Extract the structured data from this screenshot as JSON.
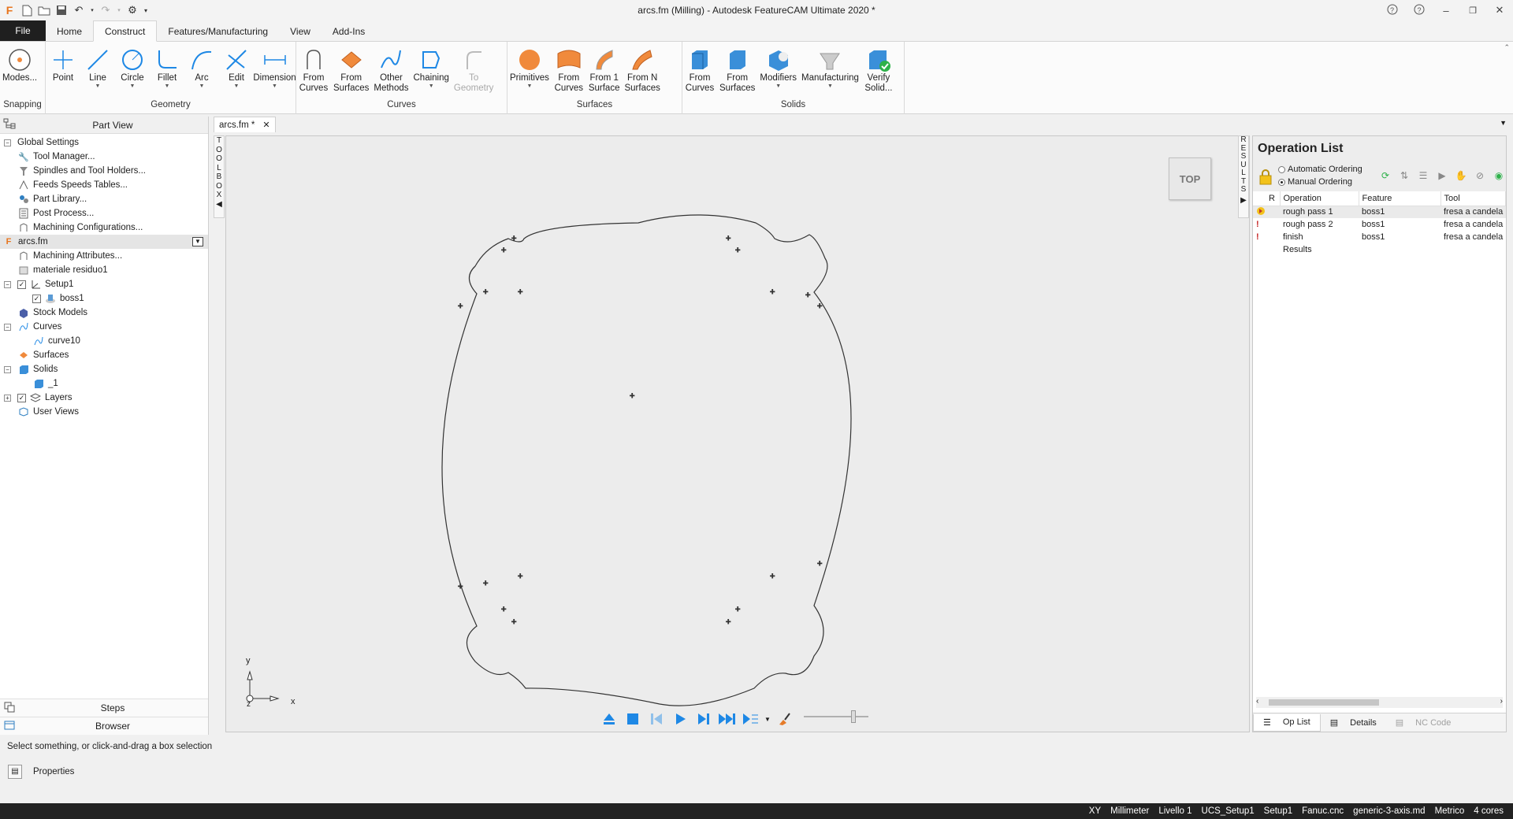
{
  "window": {
    "title": "arcs.fm (Milling) - Autodesk FeatureCAM Ultimate 2020 *",
    "app_icon": "F"
  },
  "ribbon_tabs": [
    "File",
    "Home",
    "Construct",
    "Features/Manufacturing",
    "View",
    "Add-Ins"
  ],
  "active_tab": "Construct",
  "ribbon": {
    "snapping": {
      "label": "Snapping",
      "buttons": [
        {
          "label": "Modes...",
          "icon": "snap-modes-icon"
        }
      ]
    },
    "geometry": {
      "label": "Geometry",
      "buttons": [
        {
          "label": "Point",
          "icon": "point-icon"
        },
        {
          "label": "Line",
          "icon": "line-icon"
        },
        {
          "label": "Circle",
          "icon": "circle-icon"
        },
        {
          "label": "Fillet",
          "icon": "fillet-icon"
        },
        {
          "label": "Arc",
          "icon": "arc-icon"
        },
        {
          "label": "Edit",
          "icon": "edit-icon"
        },
        {
          "label": "Dimension",
          "icon": "dimension-icon"
        }
      ]
    },
    "curves": {
      "label": "Curves",
      "buttons": [
        {
          "label": "From\nCurves",
          "icon": "curve-from-curves-icon"
        },
        {
          "label": "From\nSurfaces",
          "icon": "curve-from-surfaces-icon"
        },
        {
          "label": "Other\nMethods",
          "icon": "curve-other-methods-icon"
        },
        {
          "label": "Chaining",
          "icon": "chaining-icon"
        },
        {
          "label": "To\nGeometry",
          "icon": "to-geometry-icon"
        }
      ]
    },
    "surfaces": {
      "label": "Surfaces",
      "buttons": [
        {
          "label": "Primitives",
          "icon": "primitives-icon"
        },
        {
          "label": "From\nCurves",
          "icon": "surface-from-curves-icon"
        },
        {
          "label": "From 1\nSurface",
          "icon": "from-1-surface-icon"
        },
        {
          "label": "From N\nSurfaces",
          "icon": "from-n-surfaces-icon"
        }
      ]
    },
    "solids": {
      "label": "Solids",
      "buttons": [
        {
          "label": "From\nCurves",
          "icon": "solid-from-curves-icon"
        },
        {
          "label": "From\nSurfaces",
          "icon": "solid-from-surfaces-icon"
        },
        {
          "label": "Modifiers",
          "icon": "modifiers-icon"
        },
        {
          "label": "Manufacturing",
          "icon": "manufacturing-icon"
        },
        {
          "label": "Verify\nSolid...",
          "icon": "verify-solid-icon"
        }
      ]
    }
  },
  "part_view": {
    "title": "Part View",
    "items": [
      "Global Settings",
      "Tool Manager...",
      "Spindles and Tool Holders...",
      "Feeds  Speeds Tables...",
      "Part Library...",
      "Post Process...",
      "Machining Configurations...",
      "arcs.fm",
      "Machining Attributes...",
      "materiale residuo1",
      "Setup1",
      "boss1",
      "Stock Models",
      "Curves",
      "curve10",
      "Surfaces",
      "Solids",
      "_1",
      "Layers",
      "User Views"
    ],
    "bottom": {
      "steps": "Steps",
      "browser": "Browser"
    }
  },
  "document_tab": "arcs.fm *",
  "toolbox_label": [
    "T",
    "O",
    "O",
    "L",
    "B",
    "O",
    "X"
  ],
  "results_label": [
    "R",
    "E",
    "S",
    "U",
    "L",
    "T",
    "S"
  ],
  "viewcube_label": "TOP",
  "axes": {
    "y": "y",
    "x": "x",
    "z": "z"
  },
  "operation_list": {
    "title": "Operation List",
    "ordering": {
      "automatic": "Automatic Ordering",
      "manual": "Manual Ordering",
      "selected": "manual"
    },
    "columns": [
      "R",
      "Operation",
      "Feature",
      "Tool"
    ],
    "rows": [
      {
        "operation": "rough pass 1",
        "feature": "boss1",
        "tool": "fresa a candela"
      },
      {
        "operation": "rough pass 2",
        "feature": "boss1",
        "tool": "fresa a candela"
      },
      {
        "operation": "finish",
        "feature": "boss1",
        "tool": "fresa a candela"
      },
      {
        "operation": "Results",
        "feature": "",
        "tool": ""
      }
    ],
    "tabs": [
      "Op List",
      "Details",
      "NC Code"
    ]
  },
  "status_line": "Select something, or click-and-drag a box selection",
  "properties_label": "Properties",
  "status_bar": [
    "XY",
    "Millimeter",
    "Livello 1",
    "UCS_Setup1",
    "Setup1",
    "Fanuc.cnc",
    "generic-3-axis.md",
    "Metrico",
    "4 cores"
  ],
  "colors": {
    "accent_blue": "#1e88e5",
    "file_tab": "#1f1f1f",
    "orange": "#f08a3c",
    "status_bar": "#222222"
  }
}
